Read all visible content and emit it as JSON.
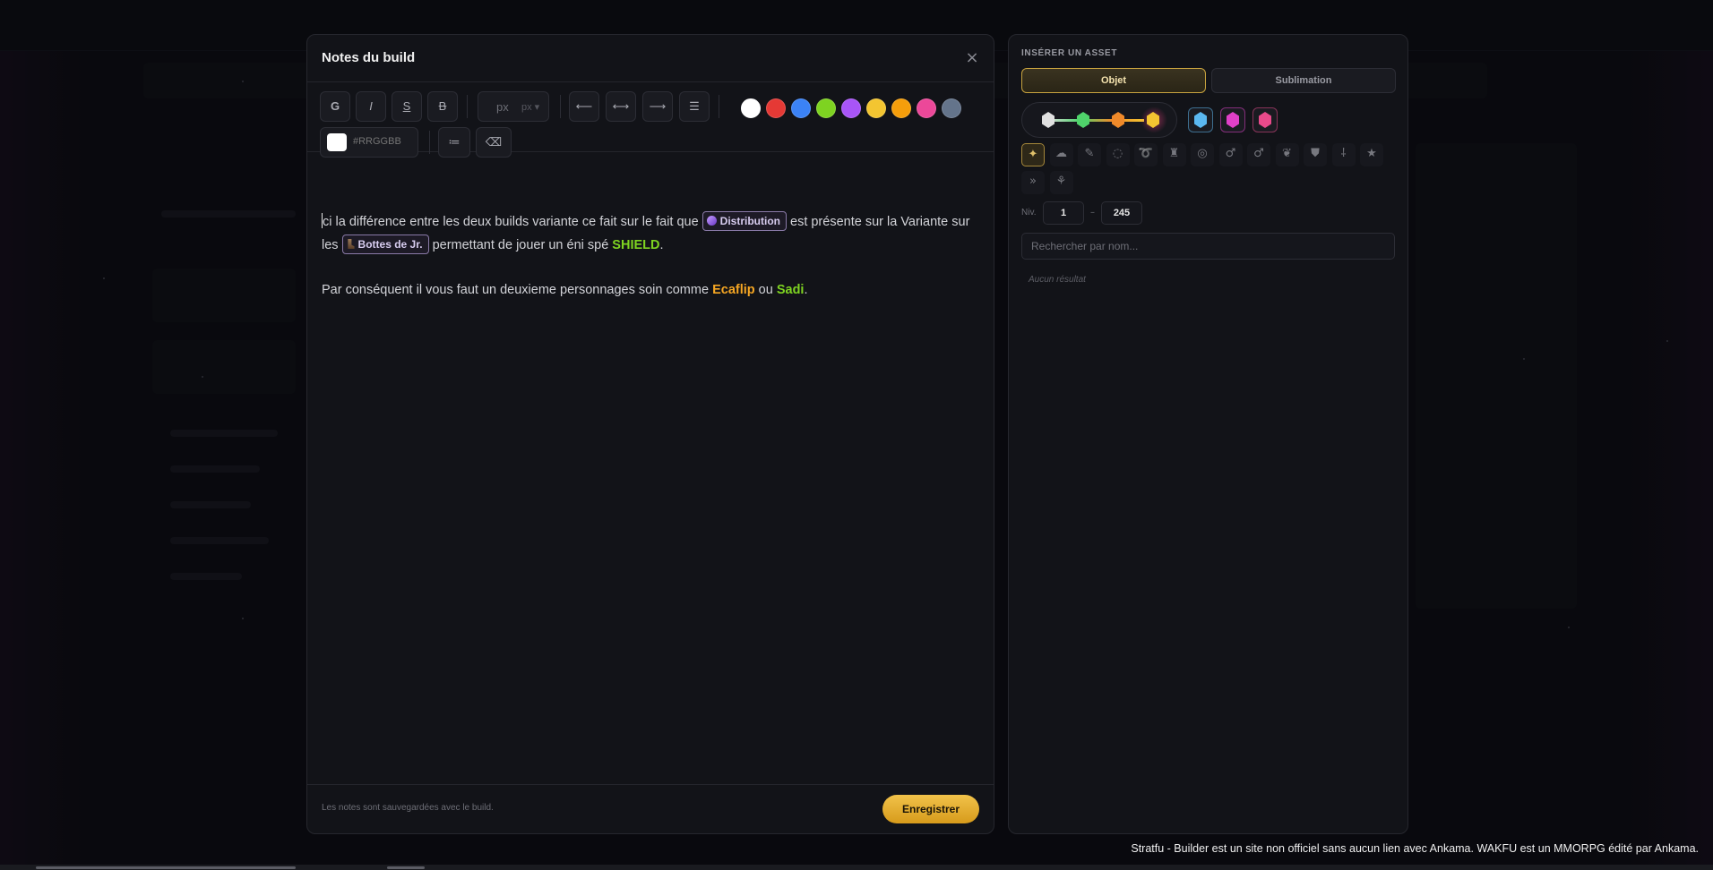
{
  "modal": {
    "title": "Notes du build",
    "close_icon": "×",
    "footer_hint": "Les notes sont sauvegardées avec le build.",
    "save_label": "Enregistrer"
  },
  "toolbar": {
    "bold": "G",
    "italic": "I",
    "strike": "S",
    "underline": "B",
    "size_value": "px",
    "size_unit": "px ▾",
    "align_left": "⟵",
    "align_center": "⟷",
    "align_right": "⟶",
    "align_justify": "☰",
    "list": "≔",
    "clear": "⌫",
    "hex_placeholder": "#RRGGBB",
    "colors": [
      "#ffffff",
      "#e53935",
      "#3b82f6",
      "#7ed321",
      "#a855f7",
      "#f3c531",
      "#f59e0b",
      "#ec4899",
      "#64748b"
    ]
  },
  "editor": {
    "p1_a": "ci la différence entre les deux builds variante ce fait sur le fait que",
    "chip1": "Distribution",
    "p1_b": "est présente sur la Variante sur les",
    "chip2": "Bottes de Jr.",
    "p1_c": "permettant de jouer un éni spé",
    "hl_shield": "SHIELD",
    "p1_d": ".",
    "p2_a": "Par conséquent il vous faut un deuxieme personnages soin comme",
    "hl_ecaflip": "Ecaflip",
    "p2_b": "ou",
    "hl_sadi": "Sadi",
    "p2_c": "."
  },
  "asset_panel": {
    "title": "INSÉRER UN ASSET",
    "tab_object": "Objet",
    "tab_sublimation": "Sublimation",
    "rarity_colors": [
      "#e0e0e0",
      "#4fd36b",
      "#f08a2a",
      "#f3c531"
    ],
    "gem_colors": [
      "#5bb8f0",
      "#e040c8",
      "#e84a8a"
    ],
    "categories": [
      "✦",
      "☁",
      "✎",
      "◌",
      "➰",
      "♜",
      "◎",
      "♂",
      "♂",
      "❦",
      "⛊",
      "⸸",
      "★",
      "»",
      "⚘"
    ],
    "level_label": "Niv.",
    "level_min": "1",
    "level_dash": "–",
    "level_max": "245",
    "search_placeholder": "Rechercher par nom...",
    "no_result": "Aucun résultat"
  },
  "disclaimer": "Stratfu - Builder est un site non officiel sans aucun lien avec Ankama. WAKFU est un MMORPG édité par Ankama."
}
